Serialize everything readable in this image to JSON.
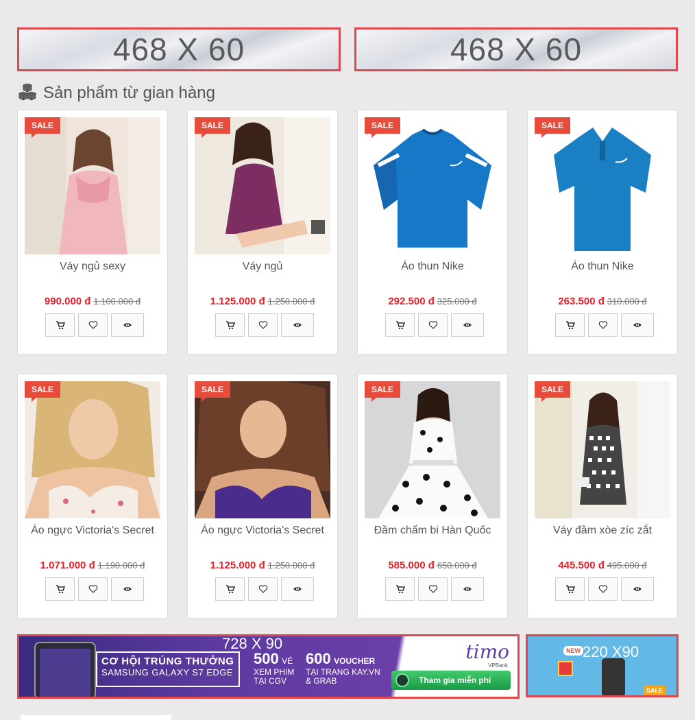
{
  "banners_top": [
    {
      "label": "468 X 60"
    },
    {
      "label": "468 X 60"
    }
  ],
  "section": {
    "title": "Sản phẩm từ gian hàng",
    "icon": "cubes-icon"
  },
  "products": [
    {
      "badge": "SALE",
      "name": "Váy ngủ sexy",
      "price": "990.000 đ",
      "old_price": "1.100.000 đ",
      "image": "pink-nightgown"
    },
    {
      "badge": "SALE",
      "name": "Váy ngủ",
      "price": "1.125.000 đ",
      "old_price": "1.250.000 đ",
      "image": "purple-nightgown"
    },
    {
      "badge": "SALE",
      "name": "Áo thun Nike",
      "price": "292.500 đ",
      "old_price": "325.000 đ",
      "image": "blue-nike-shirt"
    },
    {
      "badge": "SALE",
      "name": "Áo thun Nike",
      "price": "263.500 đ",
      "old_price": "310.000 đ",
      "image": "blue-nike-polo"
    },
    {
      "badge": "SALE",
      "name": "Áo ngực Victoria's Secret",
      "price": "1.071.000 đ",
      "old_price": "1.190.000 đ",
      "image": "floral-bra"
    },
    {
      "badge": "SALE",
      "name": "Áo ngực Victoria's Secret",
      "price": "1.125.000 đ",
      "old_price": "1.250.000 đ",
      "image": "purple-bra"
    },
    {
      "badge": "SALE",
      "name": "Đầm chấm bi Hàn Quốc",
      "price": "585.000 đ",
      "old_price": "650.000 đ",
      "image": "polka-dot-dress"
    },
    {
      "badge": "SALE",
      "name": "Váy đầm xòe zíc zắt",
      "price": "445.500 đ",
      "old_price": "495.000 đ",
      "image": "houndstooth-dress"
    }
  ],
  "product_actions": [
    "cart-icon",
    "heart-icon",
    "eye-icon"
  ],
  "banner728": {
    "size_label": "728 X 90",
    "headline1": "CƠ HỘI TRÚNG THƯỞNG",
    "headline2": "SAMSUNG GALAXY S7 EDGE",
    "num1": "500",
    "num1_unit": "VÉ",
    "num1_text": "XEM PHIM TẠI CGV",
    "num2": "600",
    "num2_unit": "VOUCHER",
    "num2_text": "TẠI TRANG KAY.VN & GRAB",
    "brand": "timo",
    "brand_sub": "VPBank",
    "cta": "Tham gia miễn phí"
  },
  "banner220": {
    "size_label": "220 X90",
    "new_label": "NEW",
    "sale_label": "SALE"
  },
  "colors": {
    "accent": "#e0474c",
    "sale": "#e64b3c",
    "price": "#e6202a",
    "background": "#ebe9ea"
  }
}
